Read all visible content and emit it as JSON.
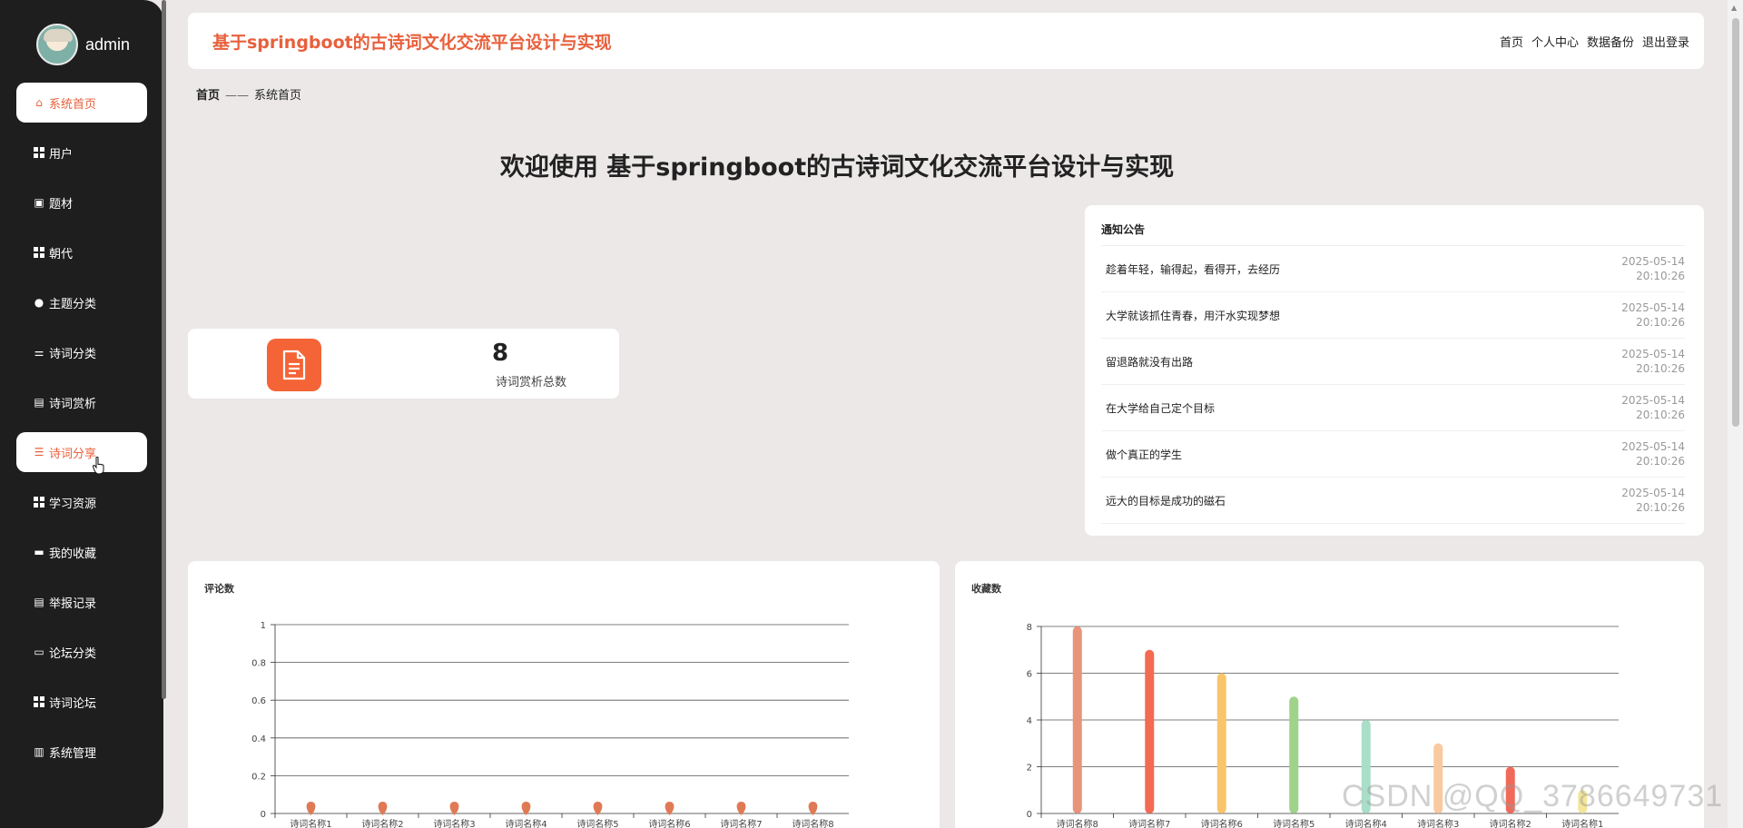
{
  "user": {
    "name": "admin"
  },
  "sidebar": {
    "items": [
      {
        "label": "系统首页",
        "icon": "home-icon",
        "active": true
      },
      {
        "label": "用户",
        "icon": "grid-icon"
      },
      {
        "label": "题材",
        "icon": "image-icon"
      },
      {
        "label": "朝代",
        "icon": "grid-icon"
      },
      {
        "label": "主题分类",
        "icon": "bulb-icon"
      },
      {
        "label": "诗词分类",
        "icon": "sliders-icon"
      },
      {
        "label": "诗词赏析",
        "icon": "clipboard-icon"
      },
      {
        "label": "诗词分享",
        "icon": "list-icon",
        "active": true
      },
      {
        "label": "学习资源",
        "icon": "grid-icon"
      },
      {
        "label": "我的收藏",
        "icon": "briefcase-icon"
      },
      {
        "label": "举报记录",
        "icon": "clipboard-icon"
      },
      {
        "label": "论坛分类",
        "icon": "monitor-icon"
      },
      {
        "label": "诗词论坛",
        "icon": "grid-icon"
      },
      {
        "label": "系统管理",
        "icon": "bars-icon"
      }
    ]
  },
  "header": {
    "title": "基于springboot的古诗词文化交流平台设计与实现",
    "nav": [
      "首页",
      "个人中心",
      "数据备份",
      "退出登录"
    ]
  },
  "breadcrumb": {
    "home": "首页",
    "sep": "——",
    "current": "系统首页"
  },
  "welcome": "欢迎使用 基于springboot的古诗词文化交流平台设计与实现",
  "stat": {
    "value": "8",
    "label": "诗词赏析总数"
  },
  "notice": {
    "title": "通知公告",
    "items": [
      {
        "text": "趁着年轻，输得起，看得开，去经历",
        "date": "2025-05-14",
        "time": "20:10:26"
      },
      {
        "text": "大学就该抓住青春，用汗水实现梦想",
        "date": "2025-05-14",
        "time": "20:10:26"
      },
      {
        "text": "留退路就没有出路",
        "date": "2025-05-14",
        "time": "20:10:26"
      },
      {
        "text": "在大学给自己定个目标",
        "date": "2025-05-14",
        "time": "20:10:26"
      },
      {
        "text": "做个真正的学生",
        "date": "2025-05-14",
        "time": "20:10:26"
      },
      {
        "text": "远大的目标是成功的磁石",
        "date": "2025-05-14",
        "time": "20:10:26"
      }
    ]
  },
  "watermark": "CSDN @QQ_3786649731",
  "colors": {
    "accent": "#e8603c",
    "sidebar": "#1e1e1e"
  },
  "chart_data": [
    {
      "type": "scatter",
      "title": "评论数",
      "categories": [
        "诗词名称1",
        "诗词名称2",
        "诗词名称3",
        "诗词名称4",
        "诗词名称5",
        "诗词名称6",
        "诗词名称7",
        "诗词名称8"
      ],
      "values": [
        0,
        0,
        0,
        0,
        0,
        0,
        0,
        0
      ],
      "yticks": [
        "0",
        "0.2",
        "0.4",
        "0.6",
        "0.8",
        "1"
      ],
      "ylim": [
        0,
        1
      ],
      "grid": true,
      "color": "#e07a55"
    },
    {
      "type": "bar",
      "title": "收藏数",
      "categories": [
        "诗词名称8",
        "诗词名称7",
        "诗词名称6",
        "诗词名称5",
        "诗词名称4",
        "诗词名称3",
        "诗词名称2",
        "诗词名称1"
      ],
      "values": [
        8,
        7,
        6,
        5,
        4,
        3,
        2,
        1
      ],
      "yticks": [
        "0",
        "2",
        "4",
        "6",
        "8"
      ],
      "ylim": [
        0,
        8
      ],
      "grid": true,
      "colors": [
        "#e8947a",
        "#f46a52",
        "#f9c56a",
        "#9fd38a",
        "#a9dec8",
        "#f9c9a0",
        "#f06a5a",
        "#f3e59a"
      ]
    }
  ]
}
